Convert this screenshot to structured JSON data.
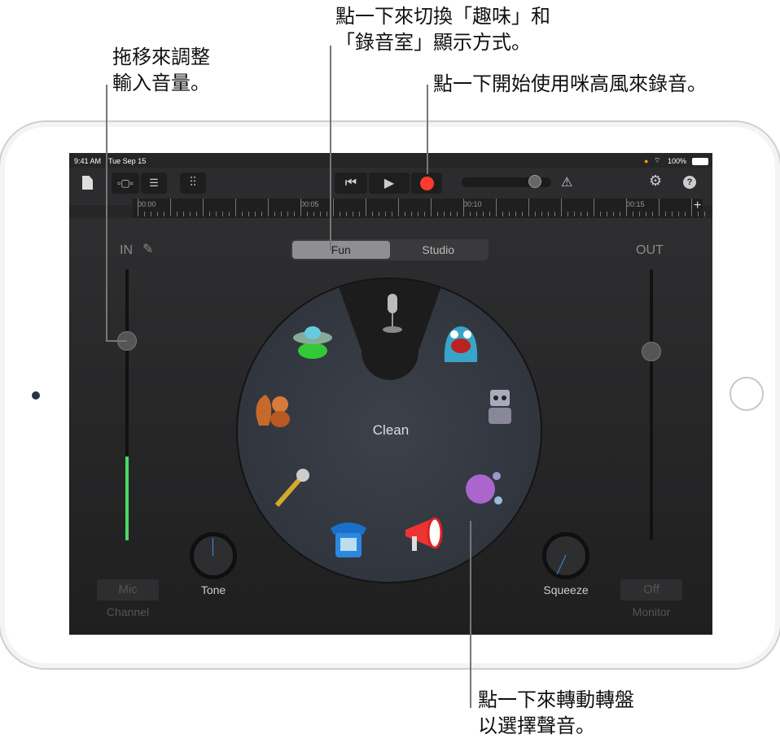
{
  "callouts": {
    "input": "拖移來調整\n輸入音量。",
    "toggle": "點一下來切換「趣味」和\n「錄音室」顯示方式。",
    "record": "點一下開始使用咪高風來錄音。",
    "wheel": "點一下來轉動轉盤\n以選擇聲音。"
  },
  "status": {
    "time": "9:41 AM",
    "date": "Tue Sep 15",
    "battery": "100%"
  },
  "ruler": [
    "00:00",
    "00:05",
    "00:10",
    "00:15"
  ],
  "mode": {
    "fun": "Fun",
    "studio": "Studio",
    "selected": "Fun"
  },
  "input": {
    "label": "IN",
    "level": 0.3,
    "slider": 0.75
  },
  "output": {
    "label": "OUT",
    "slider": 0.7
  },
  "wheel": {
    "selected": "Clean",
    "voices": [
      "microphone",
      "monster",
      "robot",
      "bubbles",
      "megaphone",
      "telephone",
      "star-mic",
      "squirrel",
      "ufo"
    ]
  },
  "knobs": {
    "tone": "Tone",
    "squeeze": "Squeeze"
  },
  "channel": {
    "button": "Mic",
    "label": "Channel"
  },
  "monitor": {
    "button": "Off",
    "label": "Monitor"
  },
  "colors": {
    "record": "#ff3b30",
    "level": "#4cd964",
    "knob_indicator": "#3b8ee8"
  }
}
